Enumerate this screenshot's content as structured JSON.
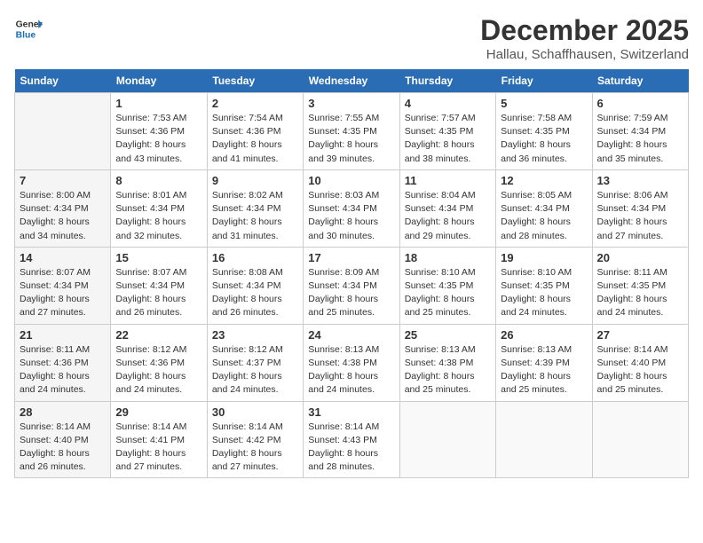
{
  "logo": {
    "line1": "General",
    "line2": "Blue"
  },
  "title": "December 2025",
  "subtitle": "Hallau, Schaffhausen, Switzerland",
  "days_of_week": [
    "Sunday",
    "Monday",
    "Tuesday",
    "Wednesday",
    "Thursday",
    "Friday",
    "Saturday"
  ],
  "weeks": [
    [
      {
        "day": "",
        "sunrise": "",
        "sunset": "",
        "daylight": ""
      },
      {
        "day": "1",
        "sunrise": "Sunrise: 7:53 AM",
        "sunset": "Sunset: 4:36 PM",
        "daylight": "Daylight: 8 hours and 43 minutes."
      },
      {
        "day": "2",
        "sunrise": "Sunrise: 7:54 AM",
        "sunset": "Sunset: 4:36 PM",
        "daylight": "Daylight: 8 hours and 41 minutes."
      },
      {
        "day": "3",
        "sunrise": "Sunrise: 7:55 AM",
        "sunset": "Sunset: 4:35 PM",
        "daylight": "Daylight: 8 hours and 39 minutes."
      },
      {
        "day": "4",
        "sunrise": "Sunrise: 7:57 AM",
        "sunset": "Sunset: 4:35 PM",
        "daylight": "Daylight: 8 hours and 38 minutes."
      },
      {
        "day": "5",
        "sunrise": "Sunrise: 7:58 AM",
        "sunset": "Sunset: 4:35 PM",
        "daylight": "Daylight: 8 hours and 36 minutes."
      },
      {
        "day": "6",
        "sunrise": "Sunrise: 7:59 AM",
        "sunset": "Sunset: 4:34 PM",
        "daylight": "Daylight: 8 hours and 35 minutes."
      }
    ],
    [
      {
        "day": "7",
        "sunrise": "Sunrise: 8:00 AM",
        "sunset": "Sunset: 4:34 PM",
        "daylight": "Daylight: 8 hours and 34 minutes."
      },
      {
        "day": "8",
        "sunrise": "Sunrise: 8:01 AM",
        "sunset": "Sunset: 4:34 PM",
        "daylight": "Daylight: 8 hours and 32 minutes."
      },
      {
        "day": "9",
        "sunrise": "Sunrise: 8:02 AM",
        "sunset": "Sunset: 4:34 PM",
        "daylight": "Daylight: 8 hours and 31 minutes."
      },
      {
        "day": "10",
        "sunrise": "Sunrise: 8:03 AM",
        "sunset": "Sunset: 4:34 PM",
        "daylight": "Daylight: 8 hours and 30 minutes."
      },
      {
        "day": "11",
        "sunrise": "Sunrise: 8:04 AM",
        "sunset": "Sunset: 4:34 PM",
        "daylight": "Daylight: 8 hours and 29 minutes."
      },
      {
        "day": "12",
        "sunrise": "Sunrise: 8:05 AM",
        "sunset": "Sunset: 4:34 PM",
        "daylight": "Daylight: 8 hours and 28 minutes."
      },
      {
        "day": "13",
        "sunrise": "Sunrise: 8:06 AM",
        "sunset": "Sunset: 4:34 PM",
        "daylight": "Daylight: 8 hours and 27 minutes."
      }
    ],
    [
      {
        "day": "14",
        "sunrise": "Sunrise: 8:07 AM",
        "sunset": "Sunset: 4:34 PM",
        "daylight": "Daylight: 8 hours and 27 minutes."
      },
      {
        "day": "15",
        "sunrise": "Sunrise: 8:07 AM",
        "sunset": "Sunset: 4:34 PM",
        "daylight": "Daylight: 8 hours and 26 minutes."
      },
      {
        "day": "16",
        "sunrise": "Sunrise: 8:08 AM",
        "sunset": "Sunset: 4:34 PM",
        "daylight": "Daylight: 8 hours and 26 minutes."
      },
      {
        "day": "17",
        "sunrise": "Sunrise: 8:09 AM",
        "sunset": "Sunset: 4:34 PM",
        "daylight": "Daylight: 8 hours and 25 minutes."
      },
      {
        "day": "18",
        "sunrise": "Sunrise: 8:10 AM",
        "sunset": "Sunset: 4:35 PM",
        "daylight": "Daylight: 8 hours and 25 minutes."
      },
      {
        "day": "19",
        "sunrise": "Sunrise: 8:10 AM",
        "sunset": "Sunset: 4:35 PM",
        "daylight": "Daylight: 8 hours and 24 minutes."
      },
      {
        "day": "20",
        "sunrise": "Sunrise: 8:11 AM",
        "sunset": "Sunset: 4:35 PM",
        "daylight": "Daylight: 8 hours and 24 minutes."
      }
    ],
    [
      {
        "day": "21",
        "sunrise": "Sunrise: 8:11 AM",
        "sunset": "Sunset: 4:36 PM",
        "daylight": "Daylight: 8 hours and 24 minutes."
      },
      {
        "day": "22",
        "sunrise": "Sunrise: 8:12 AM",
        "sunset": "Sunset: 4:36 PM",
        "daylight": "Daylight: 8 hours and 24 minutes."
      },
      {
        "day": "23",
        "sunrise": "Sunrise: 8:12 AM",
        "sunset": "Sunset: 4:37 PM",
        "daylight": "Daylight: 8 hours and 24 minutes."
      },
      {
        "day": "24",
        "sunrise": "Sunrise: 8:13 AM",
        "sunset": "Sunset: 4:38 PM",
        "daylight": "Daylight: 8 hours and 24 minutes."
      },
      {
        "day": "25",
        "sunrise": "Sunrise: 8:13 AM",
        "sunset": "Sunset: 4:38 PM",
        "daylight": "Daylight: 8 hours and 25 minutes."
      },
      {
        "day": "26",
        "sunrise": "Sunrise: 8:13 AM",
        "sunset": "Sunset: 4:39 PM",
        "daylight": "Daylight: 8 hours and 25 minutes."
      },
      {
        "day": "27",
        "sunrise": "Sunrise: 8:14 AM",
        "sunset": "Sunset: 4:40 PM",
        "daylight": "Daylight: 8 hours and 25 minutes."
      }
    ],
    [
      {
        "day": "28",
        "sunrise": "Sunrise: 8:14 AM",
        "sunset": "Sunset: 4:40 PM",
        "daylight": "Daylight: 8 hours and 26 minutes."
      },
      {
        "day": "29",
        "sunrise": "Sunrise: 8:14 AM",
        "sunset": "Sunset: 4:41 PM",
        "daylight": "Daylight: 8 hours and 27 minutes."
      },
      {
        "day": "30",
        "sunrise": "Sunrise: 8:14 AM",
        "sunset": "Sunset: 4:42 PM",
        "daylight": "Daylight: 8 hours and 27 minutes."
      },
      {
        "day": "31",
        "sunrise": "Sunrise: 8:14 AM",
        "sunset": "Sunset: 4:43 PM",
        "daylight": "Daylight: 8 hours and 28 minutes."
      },
      {
        "day": "",
        "sunrise": "",
        "sunset": "",
        "daylight": ""
      },
      {
        "day": "",
        "sunrise": "",
        "sunset": "",
        "daylight": ""
      },
      {
        "day": "",
        "sunrise": "",
        "sunset": "",
        "daylight": ""
      }
    ]
  ]
}
